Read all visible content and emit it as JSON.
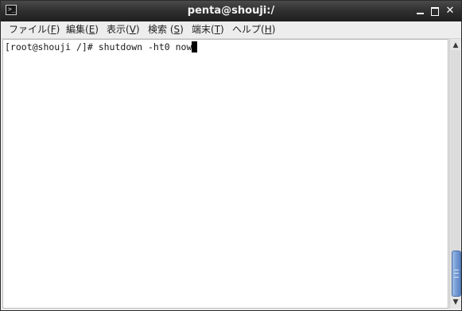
{
  "window": {
    "title": "penta@shouji:/",
    "icon": "terminal-icon",
    "controls": {
      "minimize": "minimize-icon",
      "maximize": "maximize-icon",
      "close_glyph": "✕"
    }
  },
  "menu": {
    "file": {
      "label": "ファイル(",
      "accel": "F",
      "close": ")"
    },
    "edit": {
      "label": "編集(",
      "accel": "E",
      "close": ")"
    },
    "view": {
      "label": "表示(",
      "accel": "V",
      "close": ")"
    },
    "search": {
      "label": "検索 (",
      "accel": "S",
      "close": ")"
    },
    "terminal": {
      "label": "端末(",
      "accel": "T",
      "close": ")"
    },
    "help": {
      "label": "ヘルプ(",
      "accel": "H",
      "close": ")"
    }
  },
  "terminal": {
    "line": "[root@shouji /]# shutdown -ht0 now",
    "background": "#ffffff",
    "foreground": "#1a1a1a"
  },
  "scrollbar": {
    "up_glyph": "▲",
    "down_glyph": "▼",
    "thumb_color": "#6e95d0"
  },
  "colors": {
    "titlebar": "#2f2f2f",
    "menubar": "#ededed"
  }
}
